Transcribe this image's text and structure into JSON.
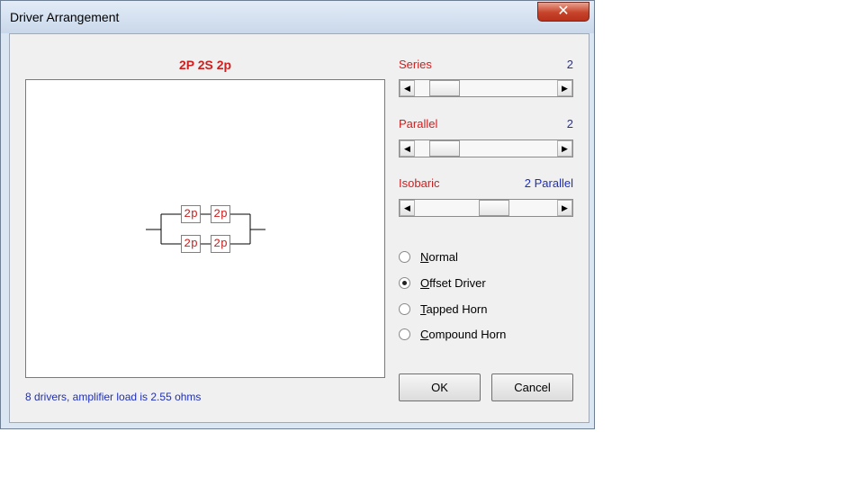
{
  "window": {
    "title": "Driver Arrangement",
    "close_glyph": "✕"
  },
  "diagram": {
    "heading": "2P 2S 2p",
    "driver_label": "2p",
    "status": "8 drivers, amplifier load is 2.55 ohms"
  },
  "controls": {
    "series": {
      "label": "Series",
      "value": "2",
      "position": 0.13
    },
    "parallel": {
      "label": "Parallel",
      "value": "2",
      "position": 0.13
    },
    "isobaric": {
      "label": "Isobaric",
      "value": "2 Parallel",
      "position": 0.57
    }
  },
  "modes": {
    "options": [
      {
        "first": "N",
        "rest": "ormal",
        "selected": false
      },
      {
        "first": "O",
        "rest": "ffset Driver",
        "selected": true
      },
      {
        "first": "T",
        "rest": "apped Horn",
        "selected": false
      },
      {
        "first": "C",
        "rest": "ompound Horn",
        "selected": false
      }
    ]
  },
  "buttons": {
    "ok": "OK",
    "cancel": "Cancel"
  },
  "colors": {
    "label_red": "#cc1f1f",
    "value_blue": "#1f2fb8",
    "close_red": "#c7432a"
  }
}
